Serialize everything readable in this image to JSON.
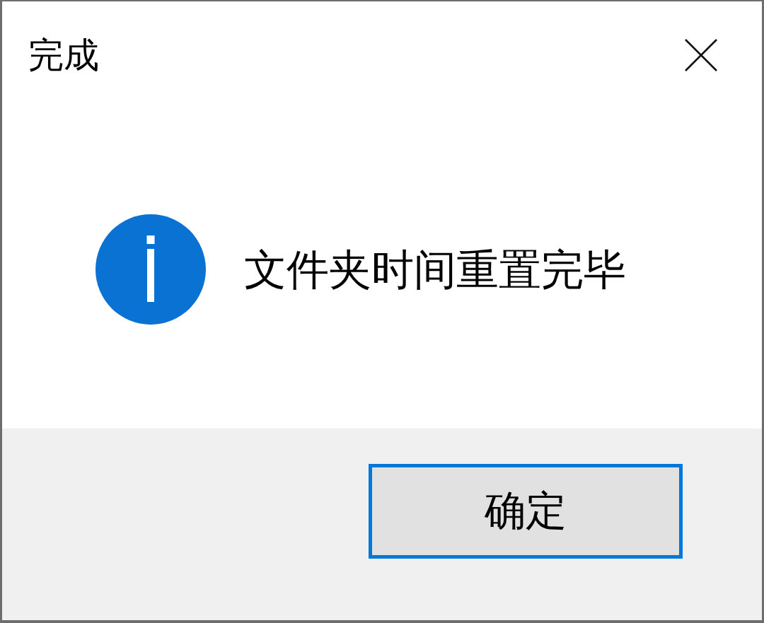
{
  "window": {
    "title": "完成"
  },
  "message": {
    "text": "文件夹时间重置完毕"
  },
  "buttons": [
    {
      "label": "确定",
      "focused": true
    }
  ]
}
